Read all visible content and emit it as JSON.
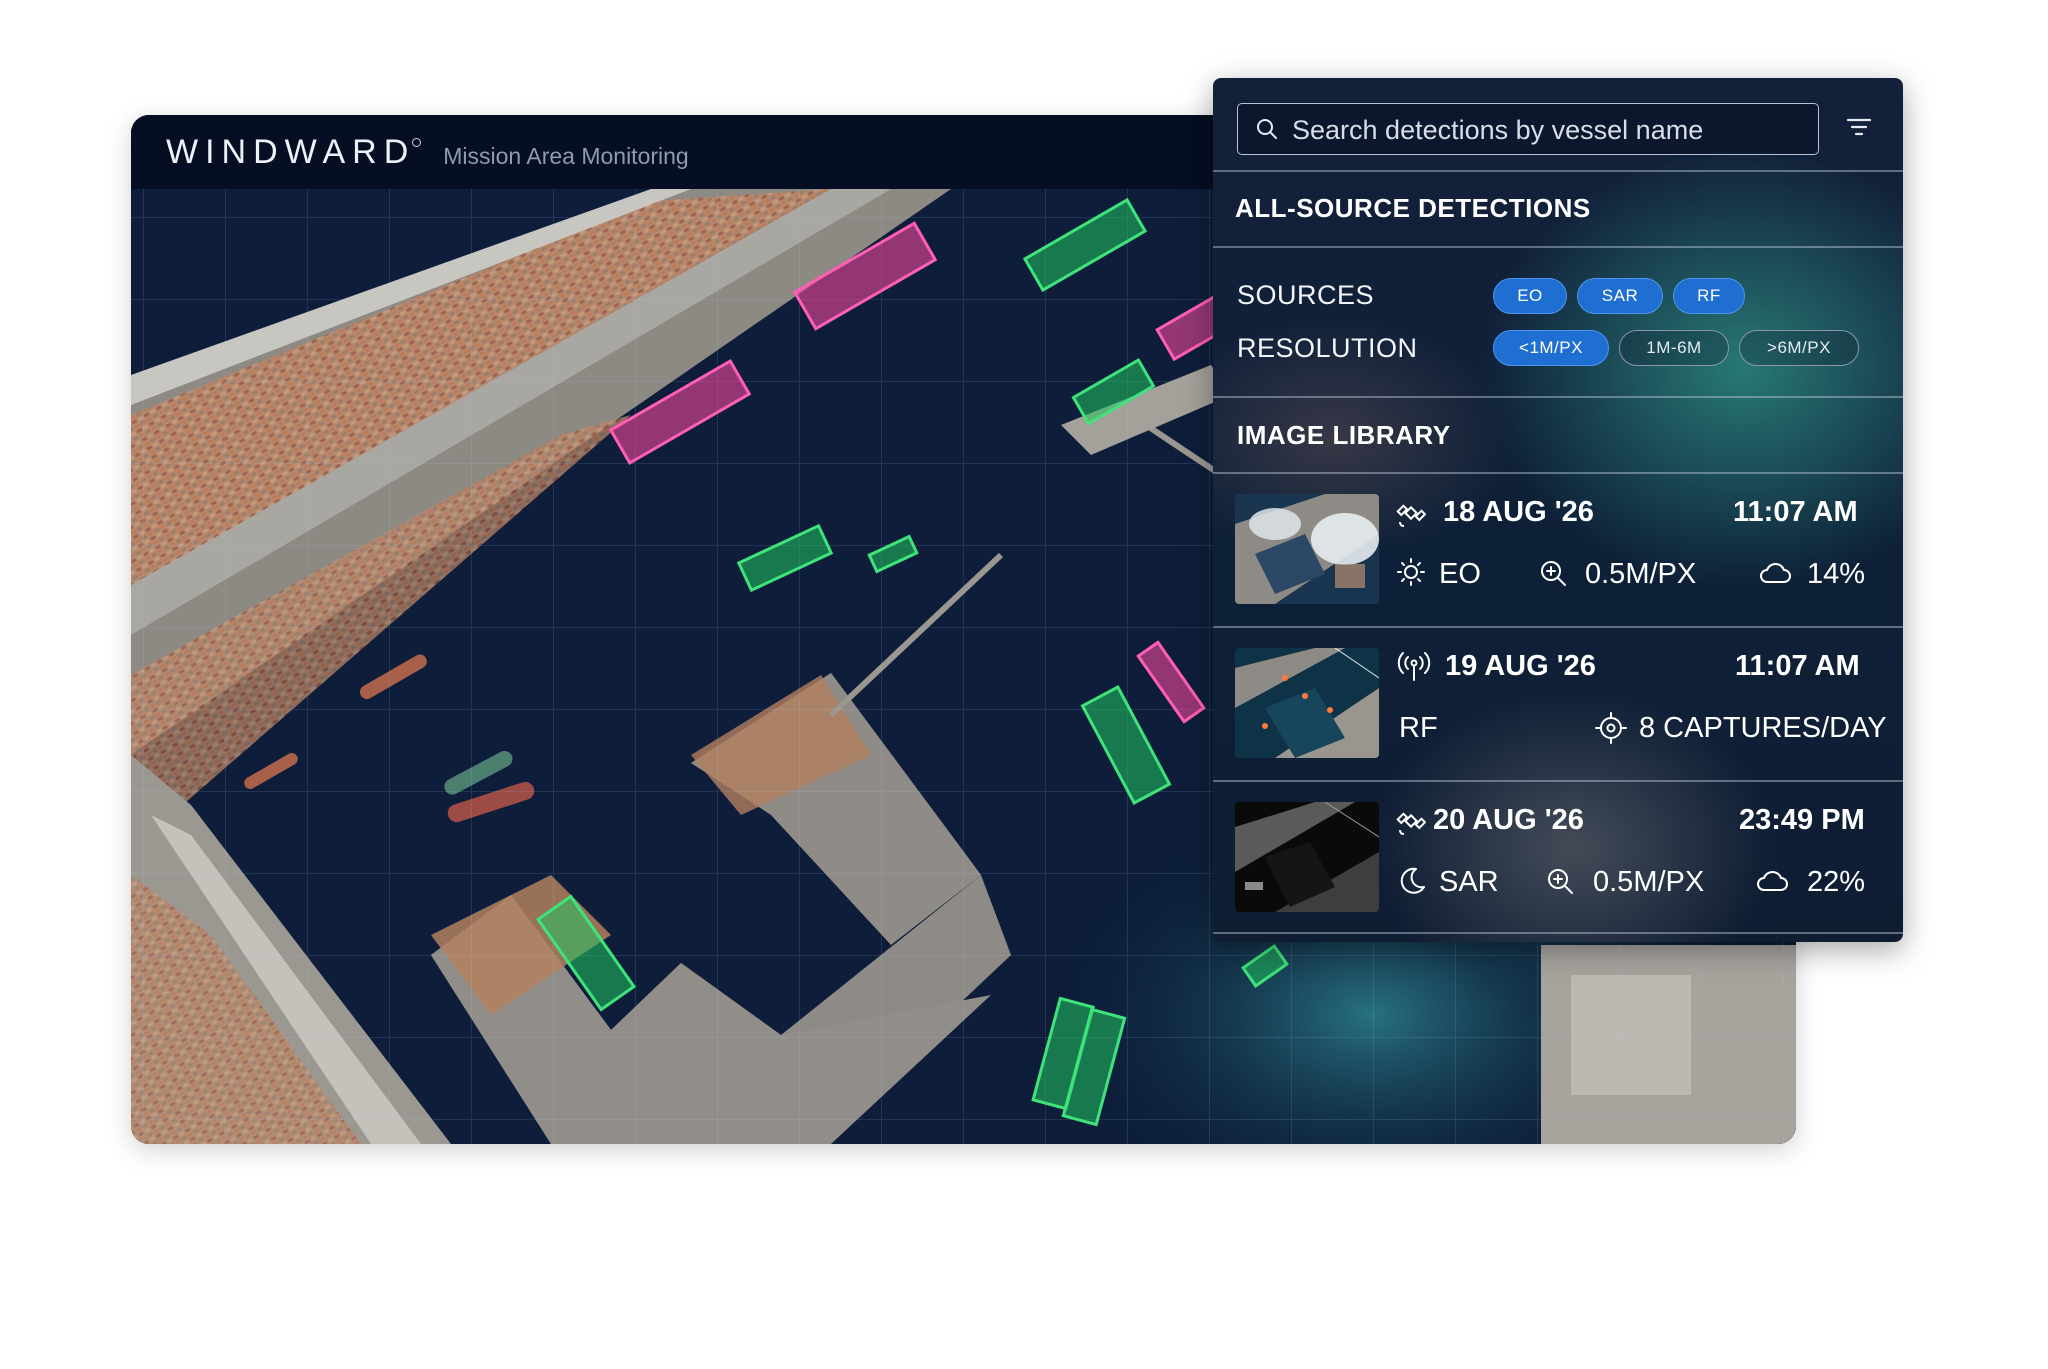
{
  "app": {
    "brand": "WINDWARD",
    "subtitle": "Mission Area Monitoring"
  },
  "search": {
    "placeholder": "Search detections by vessel name"
  },
  "detections": {
    "title": "ALL-SOURCE DETECTIONS",
    "sources_label": "SOURCES",
    "sources": [
      {
        "label": "EO",
        "selected": true
      },
      {
        "label": "SAR",
        "selected": true
      },
      {
        "label": "RF",
        "selected": true
      }
    ],
    "resolution_label": "RESOLUTION",
    "resolutions": [
      {
        "label": "<1M/PX",
        "selected": true
      },
      {
        "label": "1M-6M",
        "selected": false
      },
      {
        "label": ">6M/PX",
        "selected": false
      }
    ]
  },
  "library": {
    "title": "IMAGE LIBRARY",
    "entries": [
      {
        "date": "18 AUG '26",
        "time": "11:07 AM",
        "source_icon": "satellite-icon",
        "mode_icon": "sun-icon",
        "source": "EO",
        "resolution": "0.5M/PX",
        "cloud": "14%"
      },
      {
        "date": "19 AUG '26",
        "time": "11:07 AM",
        "source_icon": "radio-signal-icon",
        "source": "RF",
        "captures": "8 CAPTURES/DAY"
      },
      {
        "date": "20 AUG '26",
        "time": "23:49 PM",
        "source_icon": "satellite-icon",
        "mode_icon": "moon-icon",
        "source": "SAR",
        "resolution": "0.5M/PX",
        "cloud": "22%"
      }
    ]
  },
  "colors": {
    "header_bg": "#050e22",
    "panel_bg": "#0e2038",
    "chip_active": "#1e6fd1",
    "detection_green": "#22c55e",
    "detection_pink": "#ec4899",
    "sea": "#0b1a33"
  }
}
